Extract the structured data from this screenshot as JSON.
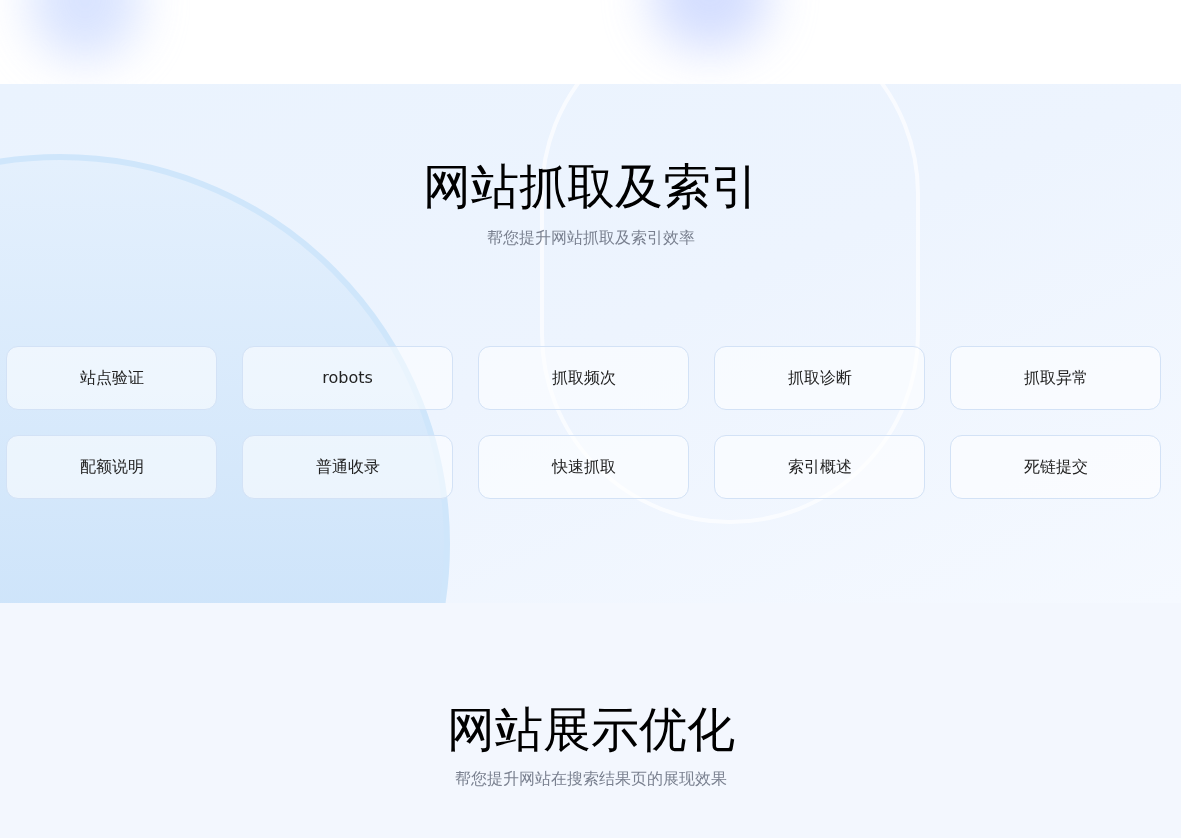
{
  "crawl_section": {
    "title": "网站抓取及索引",
    "subtitle": "帮您提升网站抓取及索引效率",
    "tools": [
      {
        "label": "站点验证"
      },
      {
        "label": "robots"
      },
      {
        "label": "抓取频次"
      },
      {
        "label": "抓取诊断"
      },
      {
        "label": "抓取异常"
      },
      {
        "label": "配额说明"
      },
      {
        "label": "普通收录"
      },
      {
        "label": "快速抓取"
      },
      {
        "label": "索引概述"
      },
      {
        "label": "死链提交"
      }
    ]
  },
  "display_section": {
    "title": "网站展示优化",
    "subtitle": "帮您提升网站在搜索结果页的展现效果"
  }
}
